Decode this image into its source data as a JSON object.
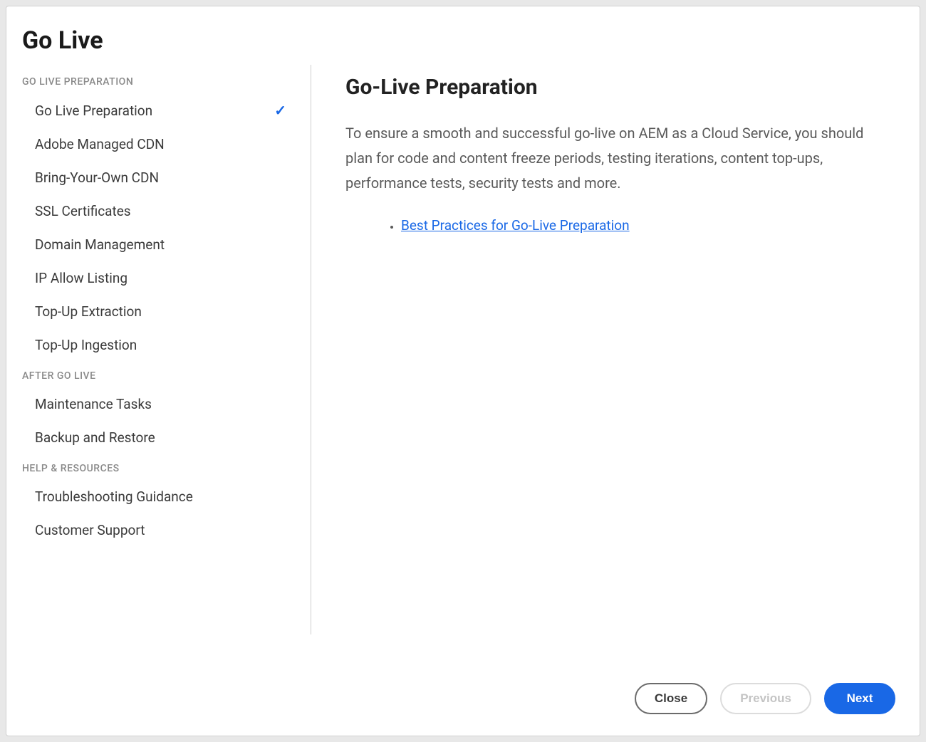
{
  "header": {
    "title": "Go Live"
  },
  "sidebar": {
    "sections": [
      {
        "header": "GO LIVE PREPARATION",
        "items": [
          {
            "label": "Go Live Preparation",
            "completed": true
          },
          {
            "label": "Adobe Managed CDN",
            "completed": false
          },
          {
            "label": "Bring-Your-Own CDN",
            "completed": false
          },
          {
            "label": "SSL Certificates",
            "completed": false
          },
          {
            "label": "Domain Management",
            "completed": false
          },
          {
            "label": "IP Allow Listing",
            "completed": false
          },
          {
            "label": "Top-Up Extraction",
            "completed": false
          },
          {
            "label": "Top-Up Ingestion",
            "completed": false
          }
        ]
      },
      {
        "header": "AFTER GO LIVE",
        "items": [
          {
            "label": "Maintenance Tasks",
            "completed": false
          },
          {
            "label": "Backup and Restore",
            "completed": false
          }
        ]
      },
      {
        "header": "HELP & RESOURCES",
        "items": [
          {
            "label": "Troubleshooting Guidance",
            "completed": false
          },
          {
            "label": "Customer Support",
            "completed": false
          }
        ]
      }
    ]
  },
  "main": {
    "title": "Go-Live Preparation",
    "body": "To ensure a smooth and successful go-live on AEM as a Cloud Service, you should plan for code and content freeze periods, testing iterations, content top-ups, performance tests, security tests and more.",
    "links": [
      {
        "label": "Best Practices for Go-Live Preparation"
      }
    ]
  },
  "footer": {
    "close": "Close",
    "previous": "Previous",
    "next": "Next"
  },
  "icons": {
    "check": "✓"
  }
}
